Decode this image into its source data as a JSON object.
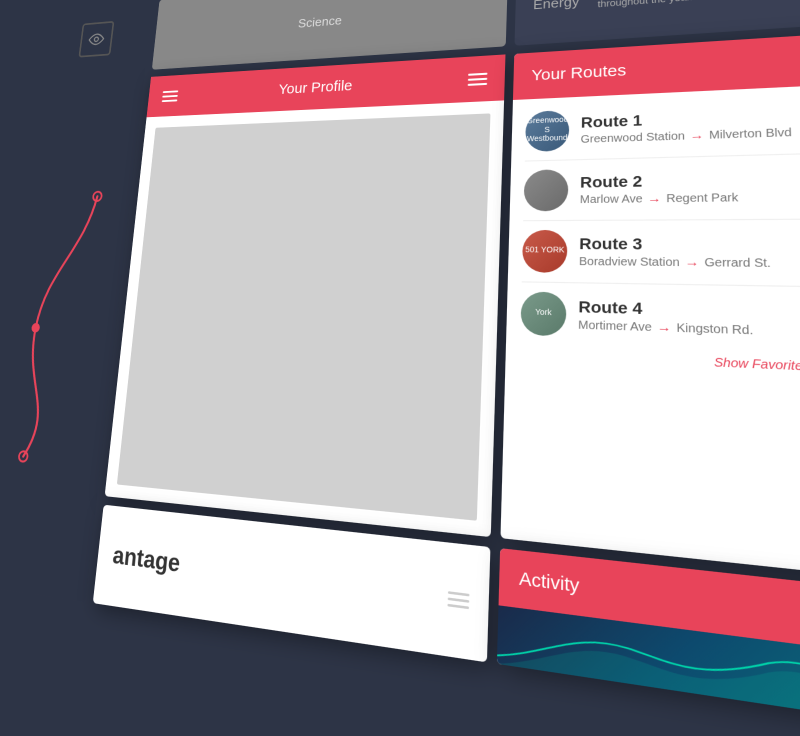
{
  "header": {
    "top_left_label": "Science",
    "top_center_label": "Energy"
  },
  "profile_panel": {
    "title": "Your Profile",
    "hamburger_label": "menu"
  },
  "routes_panel": {
    "title": "Your Routes",
    "routes": [
      {
        "id": 1,
        "name": "Route 1",
        "from": "Greenwood Station",
        "to": "Milverton Blvd",
        "favorited": true,
        "thumb_text": "Greenwood S Westbound"
      },
      {
        "id": 2,
        "name": "Route 2",
        "from": "Marlow Ave",
        "to": "Regent Park",
        "favorited": false,
        "thumb_text": ""
      },
      {
        "id": 3,
        "name": "Route 3",
        "from": "Boradview Station",
        "to": "Gerrard St.",
        "favorited": true,
        "thumb_text": "501 YORK"
      },
      {
        "id": 4,
        "name": "Route 4",
        "from": "Mortimer Ave",
        "to": "Kingston Rd.",
        "favorited": false,
        "thumb_text": "York"
      }
    ],
    "show_favorites_label": "Show Favorites Only"
  },
  "activity_panel": {
    "title": "Activity"
  },
  "bottom_panel": {
    "percentage_label": "antage"
  },
  "dots": [
    "active",
    "inactive",
    "inactive",
    "inactive"
  ],
  "colors": {
    "accent": "#e8445a",
    "dark_bg": "#2d3446",
    "panel_bg": "#ffffff"
  }
}
